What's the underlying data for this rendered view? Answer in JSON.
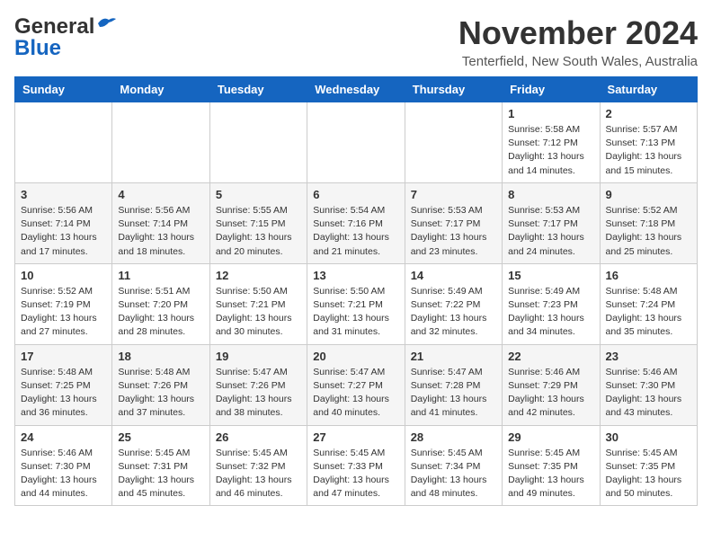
{
  "header": {
    "logo_general": "General",
    "logo_blue": "Blue",
    "month_year": "November 2024",
    "location": "Tenterfield, New South Wales, Australia"
  },
  "weekdays": [
    "Sunday",
    "Monday",
    "Tuesday",
    "Wednesday",
    "Thursday",
    "Friday",
    "Saturday"
  ],
  "weeks": [
    [
      {
        "day": "",
        "info": ""
      },
      {
        "day": "",
        "info": ""
      },
      {
        "day": "",
        "info": ""
      },
      {
        "day": "",
        "info": ""
      },
      {
        "day": "",
        "info": ""
      },
      {
        "day": "1",
        "info": "Sunrise: 5:58 AM\nSunset: 7:12 PM\nDaylight: 13 hours and 14 minutes."
      },
      {
        "day": "2",
        "info": "Sunrise: 5:57 AM\nSunset: 7:13 PM\nDaylight: 13 hours and 15 minutes."
      }
    ],
    [
      {
        "day": "3",
        "info": "Sunrise: 5:56 AM\nSunset: 7:14 PM\nDaylight: 13 hours and 17 minutes."
      },
      {
        "day": "4",
        "info": "Sunrise: 5:56 AM\nSunset: 7:14 PM\nDaylight: 13 hours and 18 minutes."
      },
      {
        "day": "5",
        "info": "Sunrise: 5:55 AM\nSunset: 7:15 PM\nDaylight: 13 hours and 20 minutes."
      },
      {
        "day": "6",
        "info": "Sunrise: 5:54 AM\nSunset: 7:16 PM\nDaylight: 13 hours and 21 minutes."
      },
      {
        "day": "7",
        "info": "Sunrise: 5:53 AM\nSunset: 7:17 PM\nDaylight: 13 hours and 23 minutes."
      },
      {
        "day": "8",
        "info": "Sunrise: 5:53 AM\nSunset: 7:17 PM\nDaylight: 13 hours and 24 minutes."
      },
      {
        "day": "9",
        "info": "Sunrise: 5:52 AM\nSunset: 7:18 PM\nDaylight: 13 hours and 25 minutes."
      }
    ],
    [
      {
        "day": "10",
        "info": "Sunrise: 5:52 AM\nSunset: 7:19 PM\nDaylight: 13 hours and 27 minutes."
      },
      {
        "day": "11",
        "info": "Sunrise: 5:51 AM\nSunset: 7:20 PM\nDaylight: 13 hours and 28 minutes."
      },
      {
        "day": "12",
        "info": "Sunrise: 5:50 AM\nSunset: 7:21 PM\nDaylight: 13 hours and 30 minutes."
      },
      {
        "day": "13",
        "info": "Sunrise: 5:50 AM\nSunset: 7:21 PM\nDaylight: 13 hours and 31 minutes."
      },
      {
        "day": "14",
        "info": "Sunrise: 5:49 AM\nSunset: 7:22 PM\nDaylight: 13 hours and 32 minutes."
      },
      {
        "day": "15",
        "info": "Sunrise: 5:49 AM\nSunset: 7:23 PM\nDaylight: 13 hours and 34 minutes."
      },
      {
        "day": "16",
        "info": "Sunrise: 5:48 AM\nSunset: 7:24 PM\nDaylight: 13 hours and 35 minutes."
      }
    ],
    [
      {
        "day": "17",
        "info": "Sunrise: 5:48 AM\nSunset: 7:25 PM\nDaylight: 13 hours and 36 minutes."
      },
      {
        "day": "18",
        "info": "Sunrise: 5:48 AM\nSunset: 7:26 PM\nDaylight: 13 hours and 37 minutes."
      },
      {
        "day": "19",
        "info": "Sunrise: 5:47 AM\nSunset: 7:26 PM\nDaylight: 13 hours and 38 minutes."
      },
      {
        "day": "20",
        "info": "Sunrise: 5:47 AM\nSunset: 7:27 PM\nDaylight: 13 hours and 40 minutes."
      },
      {
        "day": "21",
        "info": "Sunrise: 5:47 AM\nSunset: 7:28 PM\nDaylight: 13 hours and 41 minutes."
      },
      {
        "day": "22",
        "info": "Sunrise: 5:46 AM\nSunset: 7:29 PM\nDaylight: 13 hours and 42 minutes."
      },
      {
        "day": "23",
        "info": "Sunrise: 5:46 AM\nSunset: 7:30 PM\nDaylight: 13 hours and 43 minutes."
      }
    ],
    [
      {
        "day": "24",
        "info": "Sunrise: 5:46 AM\nSunset: 7:30 PM\nDaylight: 13 hours and 44 minutes."
      },
      {
        "day": "25",
        "info": "Sunrise: 5:45 AM\nSunset: 7:31 PM\nDaylight: 13 hours and 45 minutes."
      },
      {
        "day": "26",
        "info": "Sunrise: 5:45 AM\nSunset: 7:32 PM\nDaylight: 13 hours and 46 minutes."
      },
      {
        "day": "27",
        "info": "Sunrise: 5:45 AM\nSunset: 7:33 PM\nDaylight: 13 hours and 47 minutes."
      },
      {
        "day": "28",
        "info": "Sunrise: 5:45 AM\nSunset: 7:34 PM\nDaylight: 13 hours and 48 minutes."
      },
      {
        "day": "29",
        "info": "Sunrise: 5:45 AM\nSunset: 7:35 PM\nDaylight: 13 hours and 49 minutes."
      },
      {
        "day": "30",
        "info": "Sunrise: 5:45 AM\nSunset: 7:35 PM\nDaylight: 13 hours and 50 minutes."
      }
    ]
  ]
}
